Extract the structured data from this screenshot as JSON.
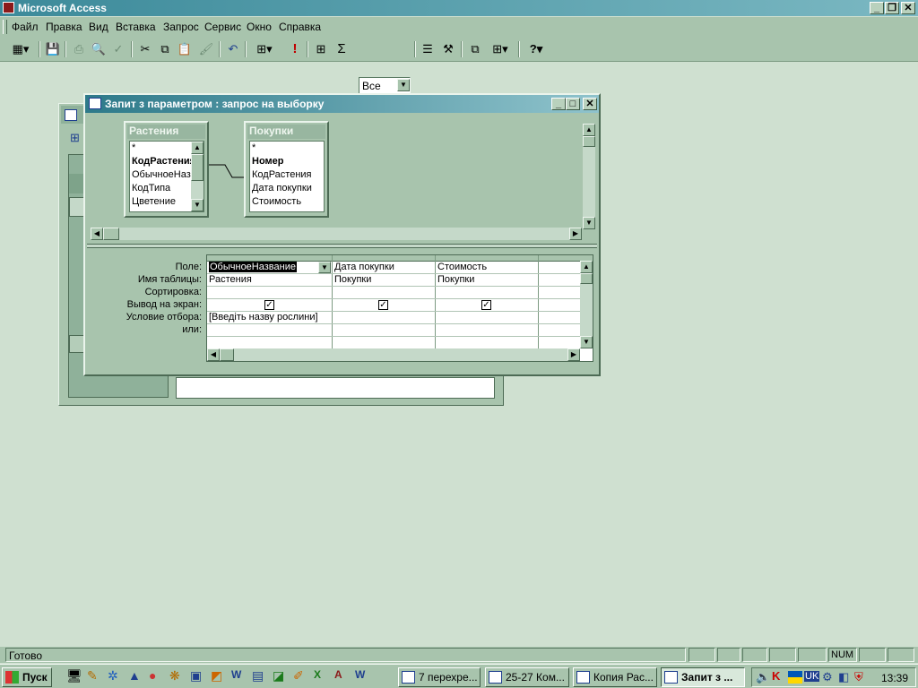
{
  "app": {
    "title": "Microsoft Access"
  },
  "menu": [
    "Файл",
    "Правка",
    "Вид",
    "Вставка",
    "Запрос",
    "Сервис",
    "Окно",
    "Справка"
  ],
  "toolbar": {
    "view_select": "Все"
  },
  "query_window": {
    "title": "Запит з параметром : запрос на выборку",
    "tables": [
      {
        "name": "Растения",
        "fields": [
          "*",
          "КодРастения",
          "ОбычноеНазв",
          "КодТипа",
          "Цветение"
        ]
      },
      {
        "name": "Покупки",
        "fields": [
          "*",
          "Номер",
          "КодРастения",
          "Дата покупки",
          "Стоимость"
        ]
      }
    ],
    "grid": {
      "row_labels": [
        "Поле:",
        "Имя таблицы:",
        "Сортировка:",
        "Вывод на экран:",
        "Условие отбора:",
        "или:"
      ],
      "columns": [
        {
          "field": "ОбычноеНазвание",
          "table": "Растения",
          "sort": "",
          "show": true,
          "criteria": "[Введіть назву рослини]"
        },
        {
          "field": "Дата покупки",
          "table": "Покупки",
          "sort": "",
          "show": true,
          "criteria": ""
        },
        {
          "field": "Стоимость",
          "table": "Покупки",
          "sort": "",
          "show": true,
          "criteria": ""
        }
      ]
    }
  },
  "status": {
    "text": "Готово",
    "num": "NUM"
  },
  "taskbar": {
    "start": "Пуск",
    "buttons": [
      "7 перехре...",
      "25-27 Ком...",
      "Копия Рас...",
      "Запит з ..."
    ],
    "lang": "UK",
    "clock": "13:39"
  },
  "colors": {
    "title_bar": "#3c8a9a",
    "window_bg": "#a8c4ad",
    "desktop": "#cfe0d0"
  }
}
